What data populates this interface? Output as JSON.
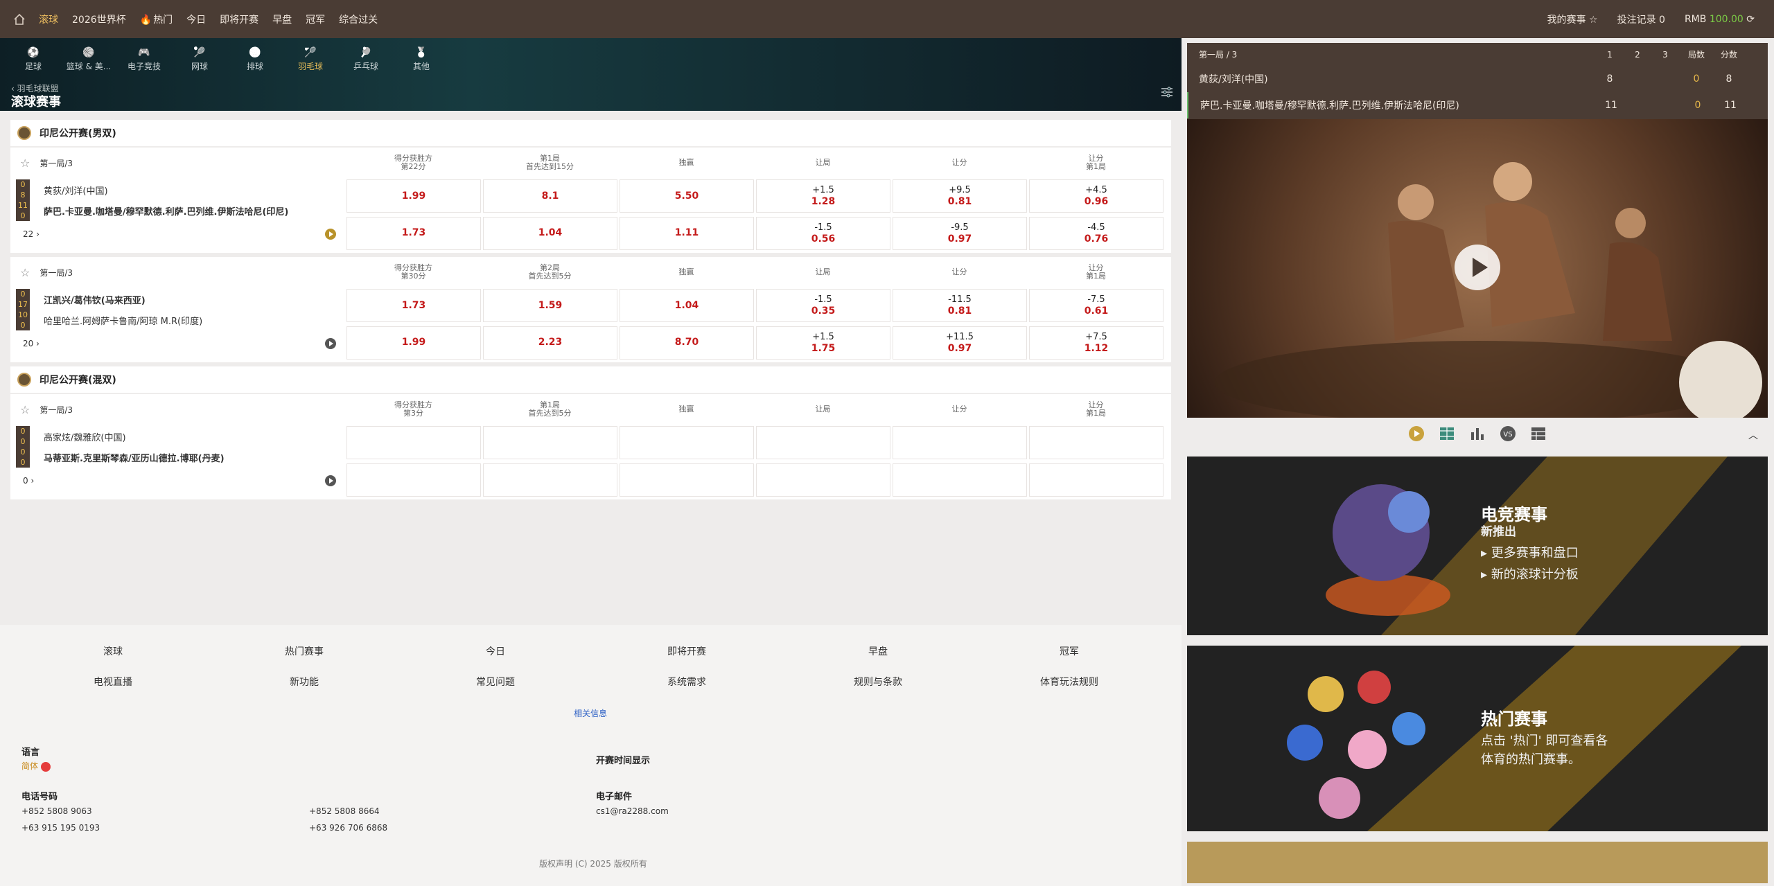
{
  "nav": {
    "items": [
      "滚球",
      "2026世界杯",
      "热门",
      "今日",
      "即将开赛",
      "早盘",
      "冠军",
      "综合过关"
    ],
    "my_events": "我的赛事",
    "bet_record": "投注记录 0",
    "currency": "RMB",
    "balance": "100.00"
  },
  "sports": [
    "足球",
    "篮球 & 美...",
    "电子竞技",
    "网球",
    "排球",
    "羽毛球",
    "乒乓球",
    "其他"
  ],
  "crumb": "羽毛球联盟",
  "page_title": "滚球赛事",
  "leagues": [
    {
      "name": "印尼公开赛(男双)",
      "matches": [
        {
          "period": "第一局/3",
          "headers": [
            [
              "得分获胜方",
              "第22分"
            ],
            [
              "第1局",
              "首先达到15分"
            ],
            [
              "独赢",
              ""
            ],
            [
              "让局",
              ""
            ],
            [
              "让分",
              ""
            ],
            [
              "让分",
              "第1局"
            ]
          ],
          "scores": [
            "0",
            "8",
            "11",
            "0"
          ],
          "team1": "黄荻/刘洋(中国)",
          "team2": "萨巴.卡亚曼.咖塔曼/穆罕默德.利萨.巴列维.伊斯法哈尼(印尼)",
          "bold_team": 2,
          "more": "22",
          "odds": [
            [
              [
                "",
                "1.99"
              ],
              [
                "",
                "8.1"
              ],
              [
                "",
                "5.50"
              ],
              [
                "+1.5",
                "1.28"
              ],
              [
                "+9.5",
                "0.81"
              ],
              [
                "+4.5",
                "0.96"
              ]
            ],
            [
              [
                "",
                "1.73"
              ],
              [
                "",
                "1.04"
              ],
              [
                "",
                "1.11"
              ],
              [
                "-1.5",
                "0.56"
              ],
              [
                "-9.5",
                "0.97"
              ],
              [
                "-4.5",
                "0.76"
              ]
            ]
          ]
        },
        {
          "period": "第一局/3",
          "headers": [
            [
              "得分获胜方",
              "第30分"
            ],
            [
              "第2局",
              "首先达到5分"
            ],
            [
              "独赢",
              ""
            ],
            [
              "让局",
              ""
            ],
            [
              "让分",
              ""
            ],
            [
              "让分",
              "第1局"
            ]
          ],
          "scores": [
            "0",
            "17",
            "10",
            "0"
          ],
          "team1": "江凯兴/葛伟钦(马来西亚)",
          "team2": "哈里哈兰.阿姆萨卡鲁南/阿琼 M.R(印度)",
          "bold_team": 1,
          "more": "20",
          "odds": [
            [
              [
                "",
                "1.73"
              ],
              [
                "",
                "1.59"
              ],
              [
                "",
                "1.04"
              ],
              [
                "-1.5",
                "0.35"
              ],
              [
                "-11.5",
                "0.81"
              ],
              [
                "-7.5",
                "0.61"
              ]
            ],
            [
              [
                "",
                "1.99"
              ],
              [
                "",
                "2.23"
              ],
              [
                "",
                "8.70"
              ],
              [
                "+1.5",
                "1.75"
              ],
              [
                "+11.5",
                "0.97"
              ],
              [
                "+7.5",
                "1.12"
              ]
            ]
          ]
        }
      ]
    },
    {
      "name": "印尼公开赛(混双)",
      "matches": [
        {
          "period": "第一局/3",
          "headers": [
            [
              "得分获胜方",
              "第3分"
            ],
            [
              "第1局",
              "首先达到5分"
            ],
            [
              "独赢",
              ""
            ],
            [
              "让局",
              ""
            ],
            [
              "让分",
              ""
            ],
            [
              "让分",
              "第1局"
            ]
          ],
          "scores": [
            "0",
            "0",
            "0",
            "0"
          ],
          "team1": "高家炫/魏雅欣(中国)",
          "team2": "马蒂亚斯.克里斯琴森/亚历山德拉.博耶(丹麦)",
          "bold_team": 2,
          "more": "0",
          "odds": [
            [
              [
                "",
                ""
              ],
              [
                "",
                ""
              ],
              [
                "",
                ""
              ],
              [
                "",
                ""
              ],
              [
                "",
                ""
              ],
              [
                "",
                ""
              ]
            ],
            [
              [
                "",
                ""
              ],
              [
                "",
                ""
              ],
              [
                "",
                ""
              ],
              [
                "",
                ""
              ],
              [
                "",
                ""
              ],
              [
                "",
                ""
              ]
            ]
          ]
        }
      ]
    }
  ],
  "scoreboard": {
    "period": "第一局 / 3",
    "cols": [
      "1",
      "2",
      "3",
      "局数",
      "分数"
    ],
    "rows": [
      {
        "team": "黄荻/刘洋(中国)",
        "s": [
          "8",
          "",
          "",
          "0",
          "8"
        ]
      },
      {
        "team": "萨巴.卡亚曼.咖塔曼/穆罕默德.利萨.巴列维.伊斯法哈尼(印尼)",
        "s": [
          "11",
          "",
          "",
          "0",
          "11"
        ]
      }
    ]
  },
  "banner1": {
    "title": "电竞赛事",
    "sub": "新推出",
    "l1": "更多赛事和盘口",
    "l2": "新的滚球计分板"
  },
  "banner2": {
    "title": "热门赛事",
    "l1": "点击 '热门' 即可查看各",
    "l2": "体育的热门赛事。"
  },
  "footer": {
    "links": [
      "滚球",
      "热门赛事",
      "今日",
      "即将开赛",
      "早盘",
      "冠军",
      "电视直播",
      "新功能",
      "常见问题",
      "系统需求",
      "规则与条款",
      "体育玩法规则"
    ],
    "related": "相关信息",
    "lang_label": "语言",
    "lang_value": "简体",
    "time_label": "开赛时间显示",
    "phone_label": "电话号码",
    "phones": [
      "+852 5808 9063",
      "+852 5808 8664",
      "+63 915 195 0193",
      "+63 926 706 6868"
    ],
    "email_label": "电子邮件",
    "email": "cs1@ra2288.com",
    "copyright": "版权声明 (C) 2025 版权所有"
  },
  "colors": {
    "topbar": "#4a3c34",
    "odds": "#c41a1a",
    "accent": "#e0b858"
  }
}
